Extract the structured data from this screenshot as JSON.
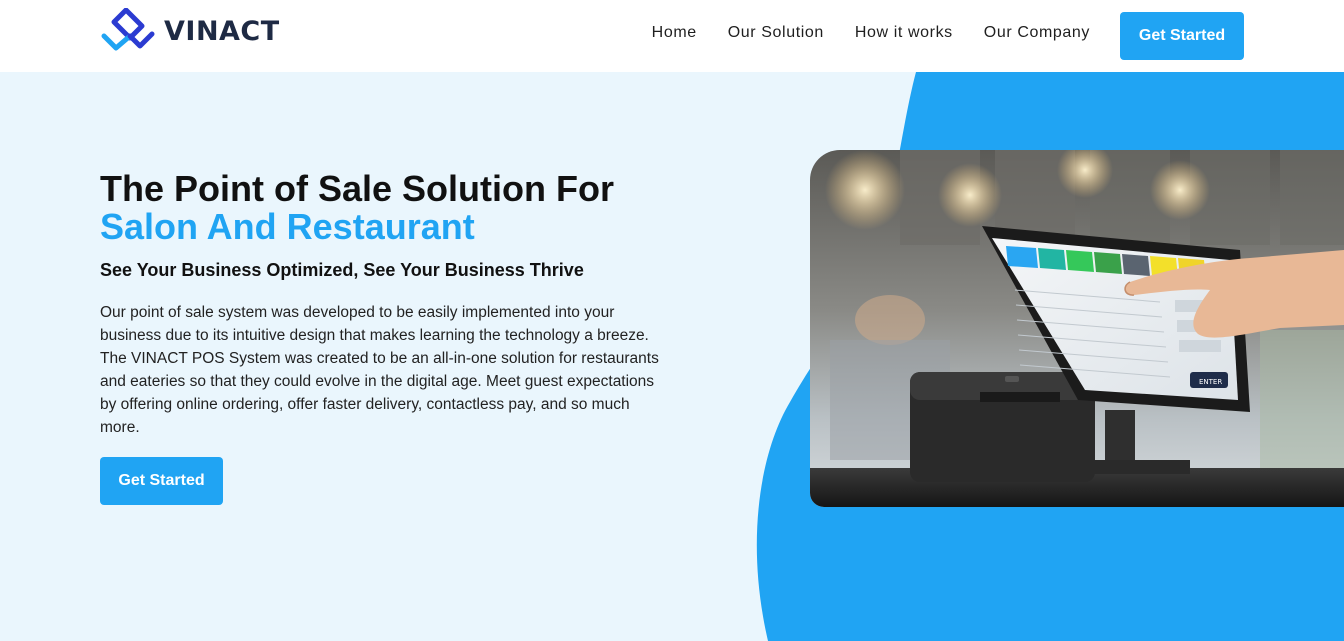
{
  "brand": {
    "name": "VINACT"
  },
  "nav": {
    "items": [
      {
        "label": "Home"
      },
      {
        "label": "Our Solution"
      },
      {
        "label": "How it works"
      },
      {
        "label": "Our Company"
      }
    ],
    "cta_label": "Get Started"
  },
  "hero": {
    "title_line1": "The Point of Sale Solution For",
    "title_line2": "Salon And Restaurant",
    "subtitle": "See Your Business Optimized, See Your Business Thrive",
    "body": "Our point of sale system was developed to be easily implemented into your business due to its intuitive design that makes learning the technology a breeze. The VINACT POS System was created to be an all-in-one solution for restaurants and eateries so that they could evolve in the digital age. Meet guest expectations by offering online ordering, offer faster delivery, contactless pay, and so much more.",
    "cta_label": "Get Started",
    "image_icon": "pos-terminal-photo",
    "screen_button_label": "ENTER"
  },
  "colors": {
    "accent": "#20a4f3",
    "hero_background": "#eaf6fd",
    "logo_dark": "#1e2a44"
  }
}
